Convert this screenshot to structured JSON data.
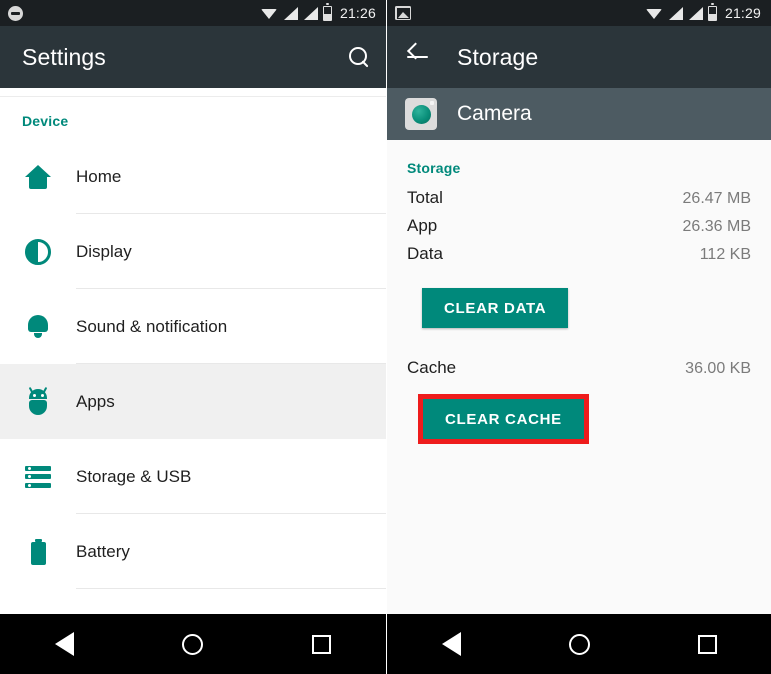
{
  "left": {
    "status_bar": {
      "icons": [
        "dnd-icon",
        "wifi-icon",
        "signal-icon",
        "signal-icon",
        "battery-icon"
      ],
      "clock": "21:26"
    },
    "toolbar": {
      "title": "Settings",
      "search_icon": "search-icon"
    },
    "section_label": "Device",
    "items": [
      {
        "label": "Home",
        "icon": "home-icon",
        "selected": false
      },
      {
        "label": "Display",
        "icon": "brightness-icon",
        "selected": false
      },
      {
        "label": "Sound & notification",
        "icon": "bell-icon",
        "selected": false
      },
      {
        "label": "Apps",
        "icon": "android-icon",
        "selected": true
      },
      {
        "label": "Storage & USB",
        "icon": "storage-icon",
        "selected": false
      },
      {
        "label": "Battery",
        "icon": "battery-icon",
        "selected": false
      }
    ],
    "nav": {
      "back": "back-nav-icon",
      "home": "home-nav-icon",
      "recents": "recents-nav-icon"
    }
  },
  "right": {
    "status_bar": {
      "icons": [
        "photo-icon",
        "wifi-icon",
        "signal-icon",
        "signal-icon",
        "battery-icon"
      ],
      "clock": "21:29"
    },
    "toolbar": {
      "title": "Storage",
      "back_icon": "back-arrow-icon"
    },
    "app_bar": {
      "app_name": "Camera",
      "app_icon": "camera-app-icon"
    },
    "storage_section": {
      "label": "Storage",
      "rows": [
        {
          "key": "Total",
          "value": "26.47 MB"
        },
        {
          "key": "App",
          "value": "26.36 MB"
        },
        {
          "key": "Data",
          "value": "112 KB"
        }
      ],
      "clear_data_button": "CLEAR DATA"
    },
    "cache_section": {
      "key": "Cache",
      "value": "36.00 KB",
      "clear_cache_button": "CLEAR CACHE"
    },
    "nav": {
      "back": "back-nav-icon",
      "home": "home-nav-icon",
      "recents": "recents-nav-icon"
    }
  },
  "colors": {
    "accent_teal": "#00897b",
    "toolbar_dark": "#2b353a",
    "app_bar_slate": "#4d5b62",
    "highlight_red": "#ee1c1c",
    "selected_row": "#f0f0f0",
    "status_bar": "#1b1f22"
  }
}
